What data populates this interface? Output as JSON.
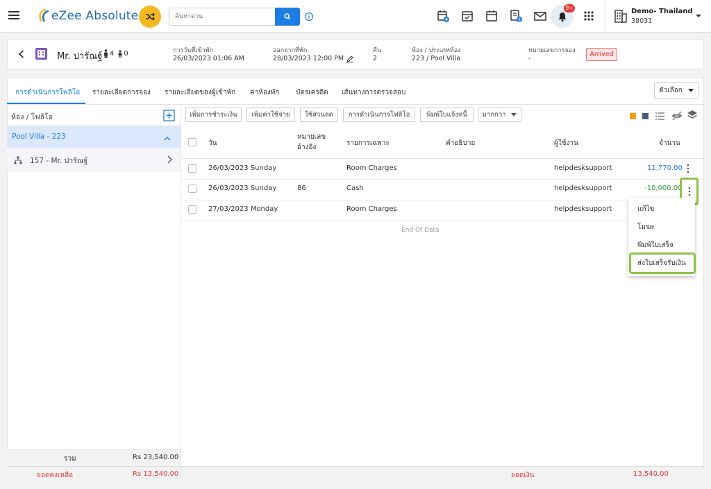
{
  "app": {
    "brand": "eZee Absolute",
    "search_placeholder": "ค้นหาด่วน",
    "notification_count": "9+",
    "hotel_name": "Demo- Thailand",
    "hotel_id": "38031"
  },
  "guest": {
    "name": "Mr. ปารัณฐ์",
    "adults": "4",
    "children": "0",
    "checkin_label": "การวันที่เข้าพัก",
    "checkin_value": "26/03/2023 01:06 AM",
    "checkout_label": "ออกจากที่พัก",
    "checkout_value": "28/03/2023 12:00 PM",
    "nights_label": "คืน",
    "nights_value": "2",
    "room_label": "ห้อง / ประเภทห้อง",
    "room_value": "223 / Pool Villa",
    "reservation_label": "หมายเลขการจอง",
    "reservation_value": "-",
    "status": "Arrived",
    "status_color": "#d32f2f"
  },
  "tabs": [
    {
      "label": "การดำเนินการโฟลิโอ",
      "active": true
    },
    {
      "label": "รายละเอียดการจอง"
    },
    {
      "label": "รายละเอียดของผู้เข้าพัก"
    },
    {
      "label": "ค่าห้องพัก"
    },
    {
      "label": "บัตรเครดิต"
    },
    {
      "label": "เส้นทางการตรวจสอบ"
    }
  ],
  "options_label": "ตัวเลือก",
  "left_panel": {
    "title": "ห้อง / โฟลิโอ",
    "room": "Pool Villa - 223",
    "guest_folio": "157 - Mr. ปารัณฐ์",
    "total_label": "รวม",
    "total_value": "Rs 23,540.00",
    "balance_label": "ยอดคงเหลือ",
    "balance_value": "Rs 13,540.00"
  },
  "toolbar": {
    "add_payment": "เพิ่มการชำระเงิน",
    "add_charge": "เพิ่มค่าใช้จ่าย",
    "apply_discount": "ใช้ส่วนลด",
    "folio_operations": "การดำเนินการโฟลิโอ",
    "print_invoice": "พิมพ์ใบแจ้งหนี้",
    "more": "มากกว่า"
  },
  "table": {
    "headers": {
      "date": "วัน",
      "ref_line1": "หมายเลข",
      "ref_line2": "อ้างอิง",
      "particulars": "รายการเฉพาะ",
      "description": "คำอธิบาย",
      "user": "ผู้ใช้งาน",
      "amount": "จำนวน"
    },
    "rows": [
      {
        "date": "26/03/2023 Sunday",
        "ref": "",
        "particular": "Room Charges",
        "description": "",
        "user": "helpdesksupport",
        "amount": "11,770.00",
        "amount_color": "#1e7de3"
      },
      {
        "date": "26/03/2023 Sunday",
        "ref": "86",
        "particular": "Cash",
        "description": "",
        "user": "helpdesksupport",
        "amount": "-10,000.00",
        "amount_color": "#2e9e2e"
      },
      {
        "date": "27/03/2023 Monday",
        "ref": "",
        "particular": "Room Charges",
        "description": "",
        "user": "helpdesksupport",
        "amount": "",
        "amount_color": "#1e7de3"
      }
    ],
    "end_text": "End Of Data",
    "footer_label": "ยอดเงิน",
    "footer_value": "13,540.00"
  },
  "context_menu": {
    "edit": "แก้ไข",
    "void": "โมฆะ",
    "print_receipt": "พิมพ์ใบเสร็จ",
    "send_receipt": "ส่งใบเสร็จรับเงิน"
  },
  "colors": {
    "accent": "#1e7de3",
    "highlight": "#8bc34a",
    "shuffle": "#f6b81f"
  }
}
